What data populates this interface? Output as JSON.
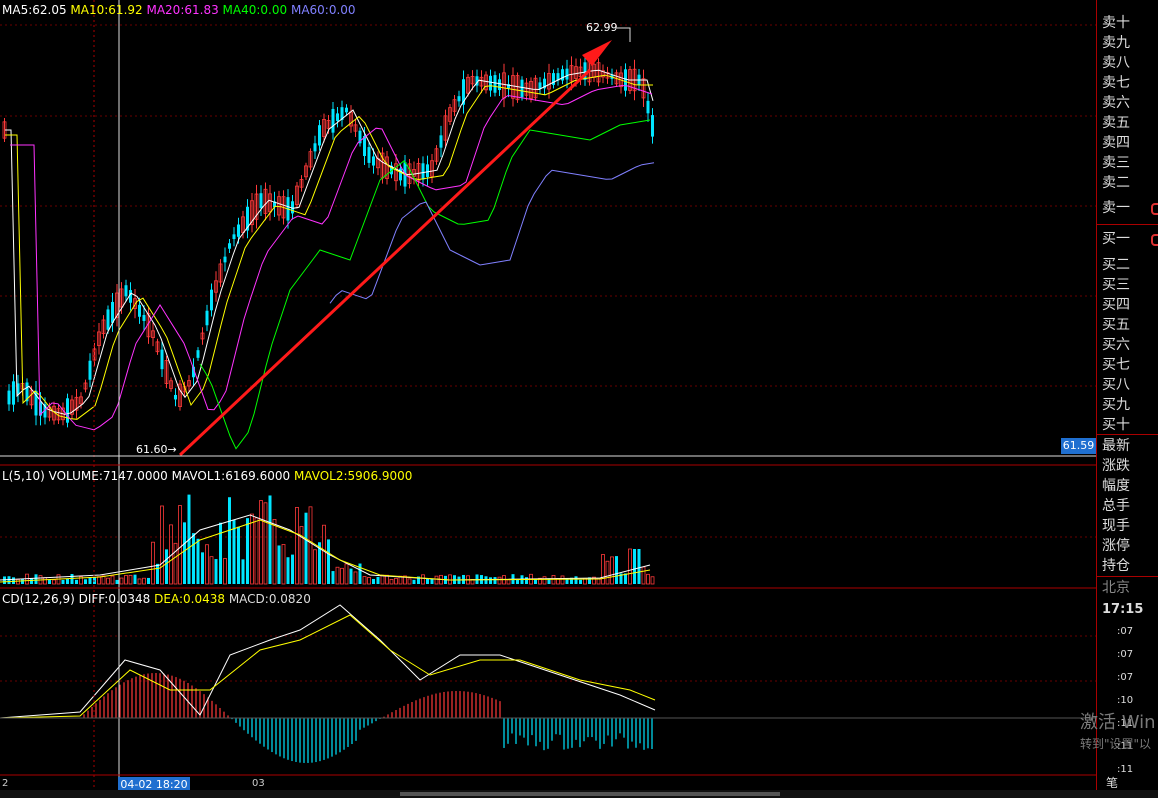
{
  "header": {
    "ma5": "MA5:62.05",
    "ma10": "MA10:61.92",
    "ma20": "MA20:61.83",
    "ma40": "MA40:0.00",
    "ma60": "MA60:0.00",
    "vol": "L(5,10) VOLUME:7147.0000",
    "mavol1": "MAVOL1:6169.6000",
    "mavol2": "MAVOL2:5906.9000",
    "macd_label": "CD(12,26,9)",
    "diff": "DIFF:0.0348",
    "dea": "DEA:0.0438",
    "macd": "MACD:0.0820"
  },
  "chart": {
    "high_label": "62.99",
    "low_label": "61.60",
    "current_price": "61.59",
    "cursor_date": "04-02 18:20",
    "x_tick_left": "2",
    "x_tick_mid": "03"
  },
  "side": {
    "asks": [
      "卖十",
      "卖九",
      "卖八",
      "卖七",
      "卖六",
      "卖五",
      "卖四",
      "卖三",
      "卖二",
      "卖一"
    ],
    "bids": [
      "买一",
      "买二",
      "买三",
      "买四",
      "买五",
      "买六",
      "买七",
      "买八",
      "买九",
      "买十"
    ],
    "info": [
      "最新",
      "涨跌",
      "幅度",
      "总手",
      "现手",
      "涨停",
      "持仓"
    ],
    "city": "北京",
    "time": "17:15",
    "ticks": [
      ":07",
      ":07",
      ":07",
      ":10",
      ":11",
      ":11",
      ":11"
    ],
    "tab": "笔"
  },
  "watermark": {
    "line1": "激活 Win",
    "line2": "转到\"设置\"以"
  },
  "colors": {
    "up": "#ff3a3a",
    "down": "#00e5ff",
    "ma5": "#ffffff",
    "ma10": "#ffff00",
    "ma20": "#ff33ff",
    "ma40": "#00ff00",
    "ma60": "#8080ff",
    "grid": "#7a0000"
  }
}
